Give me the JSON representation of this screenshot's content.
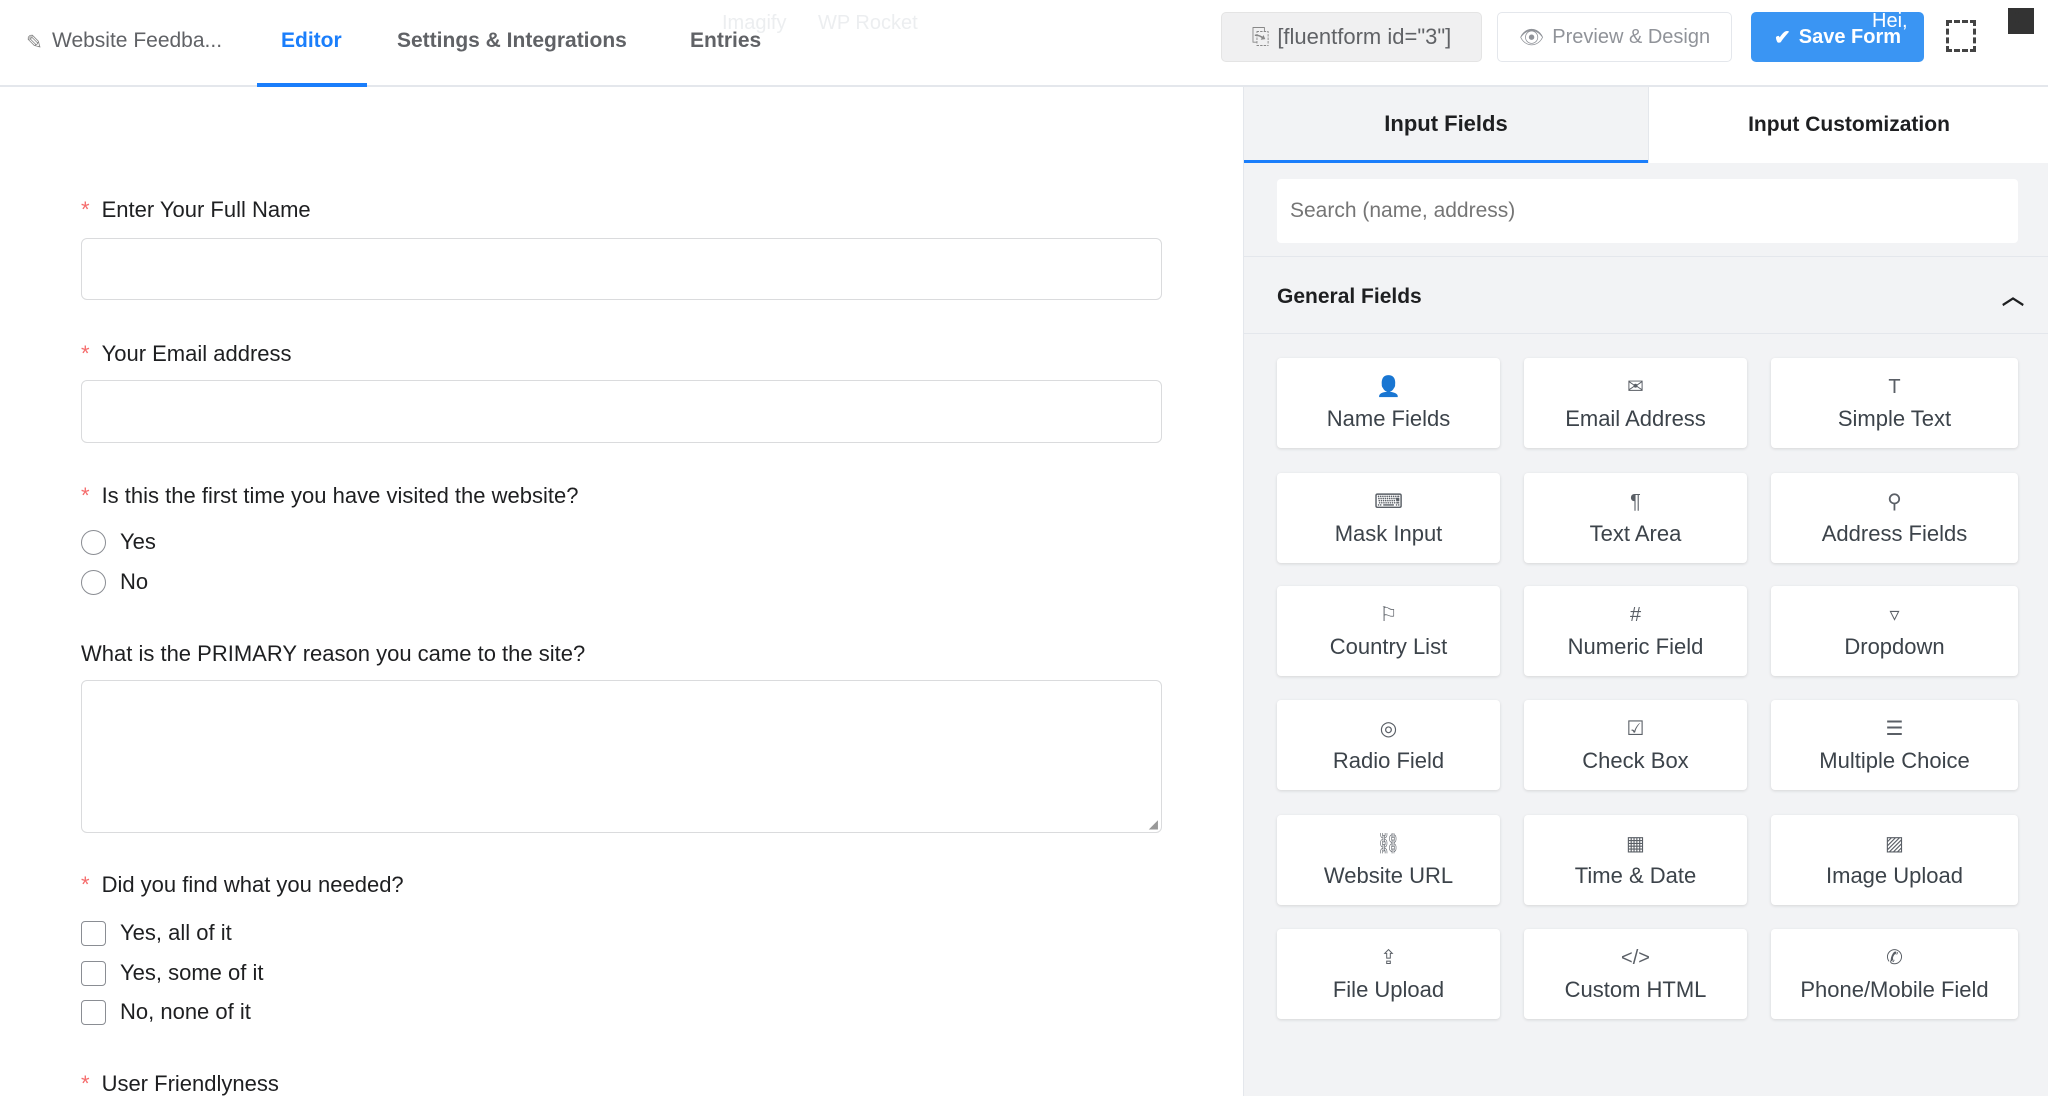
{
  "header": {
    "tabs": [
      {
        "label": "Website Feedba..."
      },
      {
        "label": "Editor"
      },
      {
        "label": "Settings & Integrations"
      },
      {
        "label": "Entries"
      }
    ],
    "faded_menu": [
      "Imagify",
      "WP Rocket"
    ],
    "shortcode": "[fluentform id=\"3\"]",
    "preview_label": "Preview & Design",
    "save_label": "Save Form",
    "greeting": "Hei,",
    "accent": "#1a7efb"
  },
  "form": {
    "q1": "Enter Your Full Name",
    "q2": "Your Email address",
    "q3": "Is this the first time you have visited the website?",
    "q3_options": [
      "Yes",
      "No"
    ],
    "q4": "What is the PRIMARY reason you came to the site?",
    "q5": "Did you find what you needed?",
    "q5_options": [
      "Yes, all of it",
      "Yes, some of it",
      "No, none of it"
    ],
    "q6": "User Friendlyness",
    "required_mark": "*"
  },
  "panel": {
    "tabs": [
      "Input Fields",
      "Input Customization"
    ],
    "search_placeholder": "Search (name, address)",
    "section_title": "General Fields",
    "fields": [
      {
        "label": "Name Fields",
        "icon": "user-icon",
        "glyph": "👤"
      },
      {
        "label": "Email Address",
        "icon": "envelope-icon",
        "glyph": "✉"
      },
      {
        "label": "Simple Text",
        "icon": "text-icon",
        "glyph": "T"
      },
      {
        "label": "Mask Input",
        "icon": "keyboard-icon",
        "glyph": "⌨"
      },
      {
        "label": "Text Area",
        "icon": "paragraph-icon",
        "glyph": "¶"
      },
      {
        "label": "Address Fields",
        "icon": "map-pin-icon",
        "glyph": "⚲"
      },
      {
        "label": "Country List",
        "icon": "flag-icon",
        "glyph": "⚐"
      },
      {
        "label": "Numeric Field",
        "icon": "hash-icon",
        "glyph": "#"
      },
      {
        "label": "Dropdown",
        "icon": "dropdown-icon",
        "glyph": "▿"
      },
      {
        "label": "Radio Field",
        "icon": "radio-icon",
        "glyph": "◎"
      },
      {
        "label": "Check Box",
        "icon": "checkbox-icon",
        "glyph": "☑"
      },
      {
        "label": "Multiple Choice",
        "icon": "list-icon",
        "glyph": "☰"
      },
      {
        "label": "Website URL",
        "icon": "link-icon",
        "glyph": "⛓"
      },
      {
        "label": "Time & Date",
        "icon": "calendar-icon",
        "glyph": "▦"
      },
      {
        "label": "Image Upload",
        "icon": "image-icon",
        "glyph": "▨"
      },
      {
        "label": "File Upload",
        "icon": "upload-icon",
        "glyph": "⇪"
      },
      {
        "label": "Custom HTML",
        "icon": "code-icon",
        "glyph": "</>"
      },
      {
        "label": "Phone/Mobile Field",
        "icon": "phone-icon",
        "glyph": "✆"
      }
    ]
  }
}
